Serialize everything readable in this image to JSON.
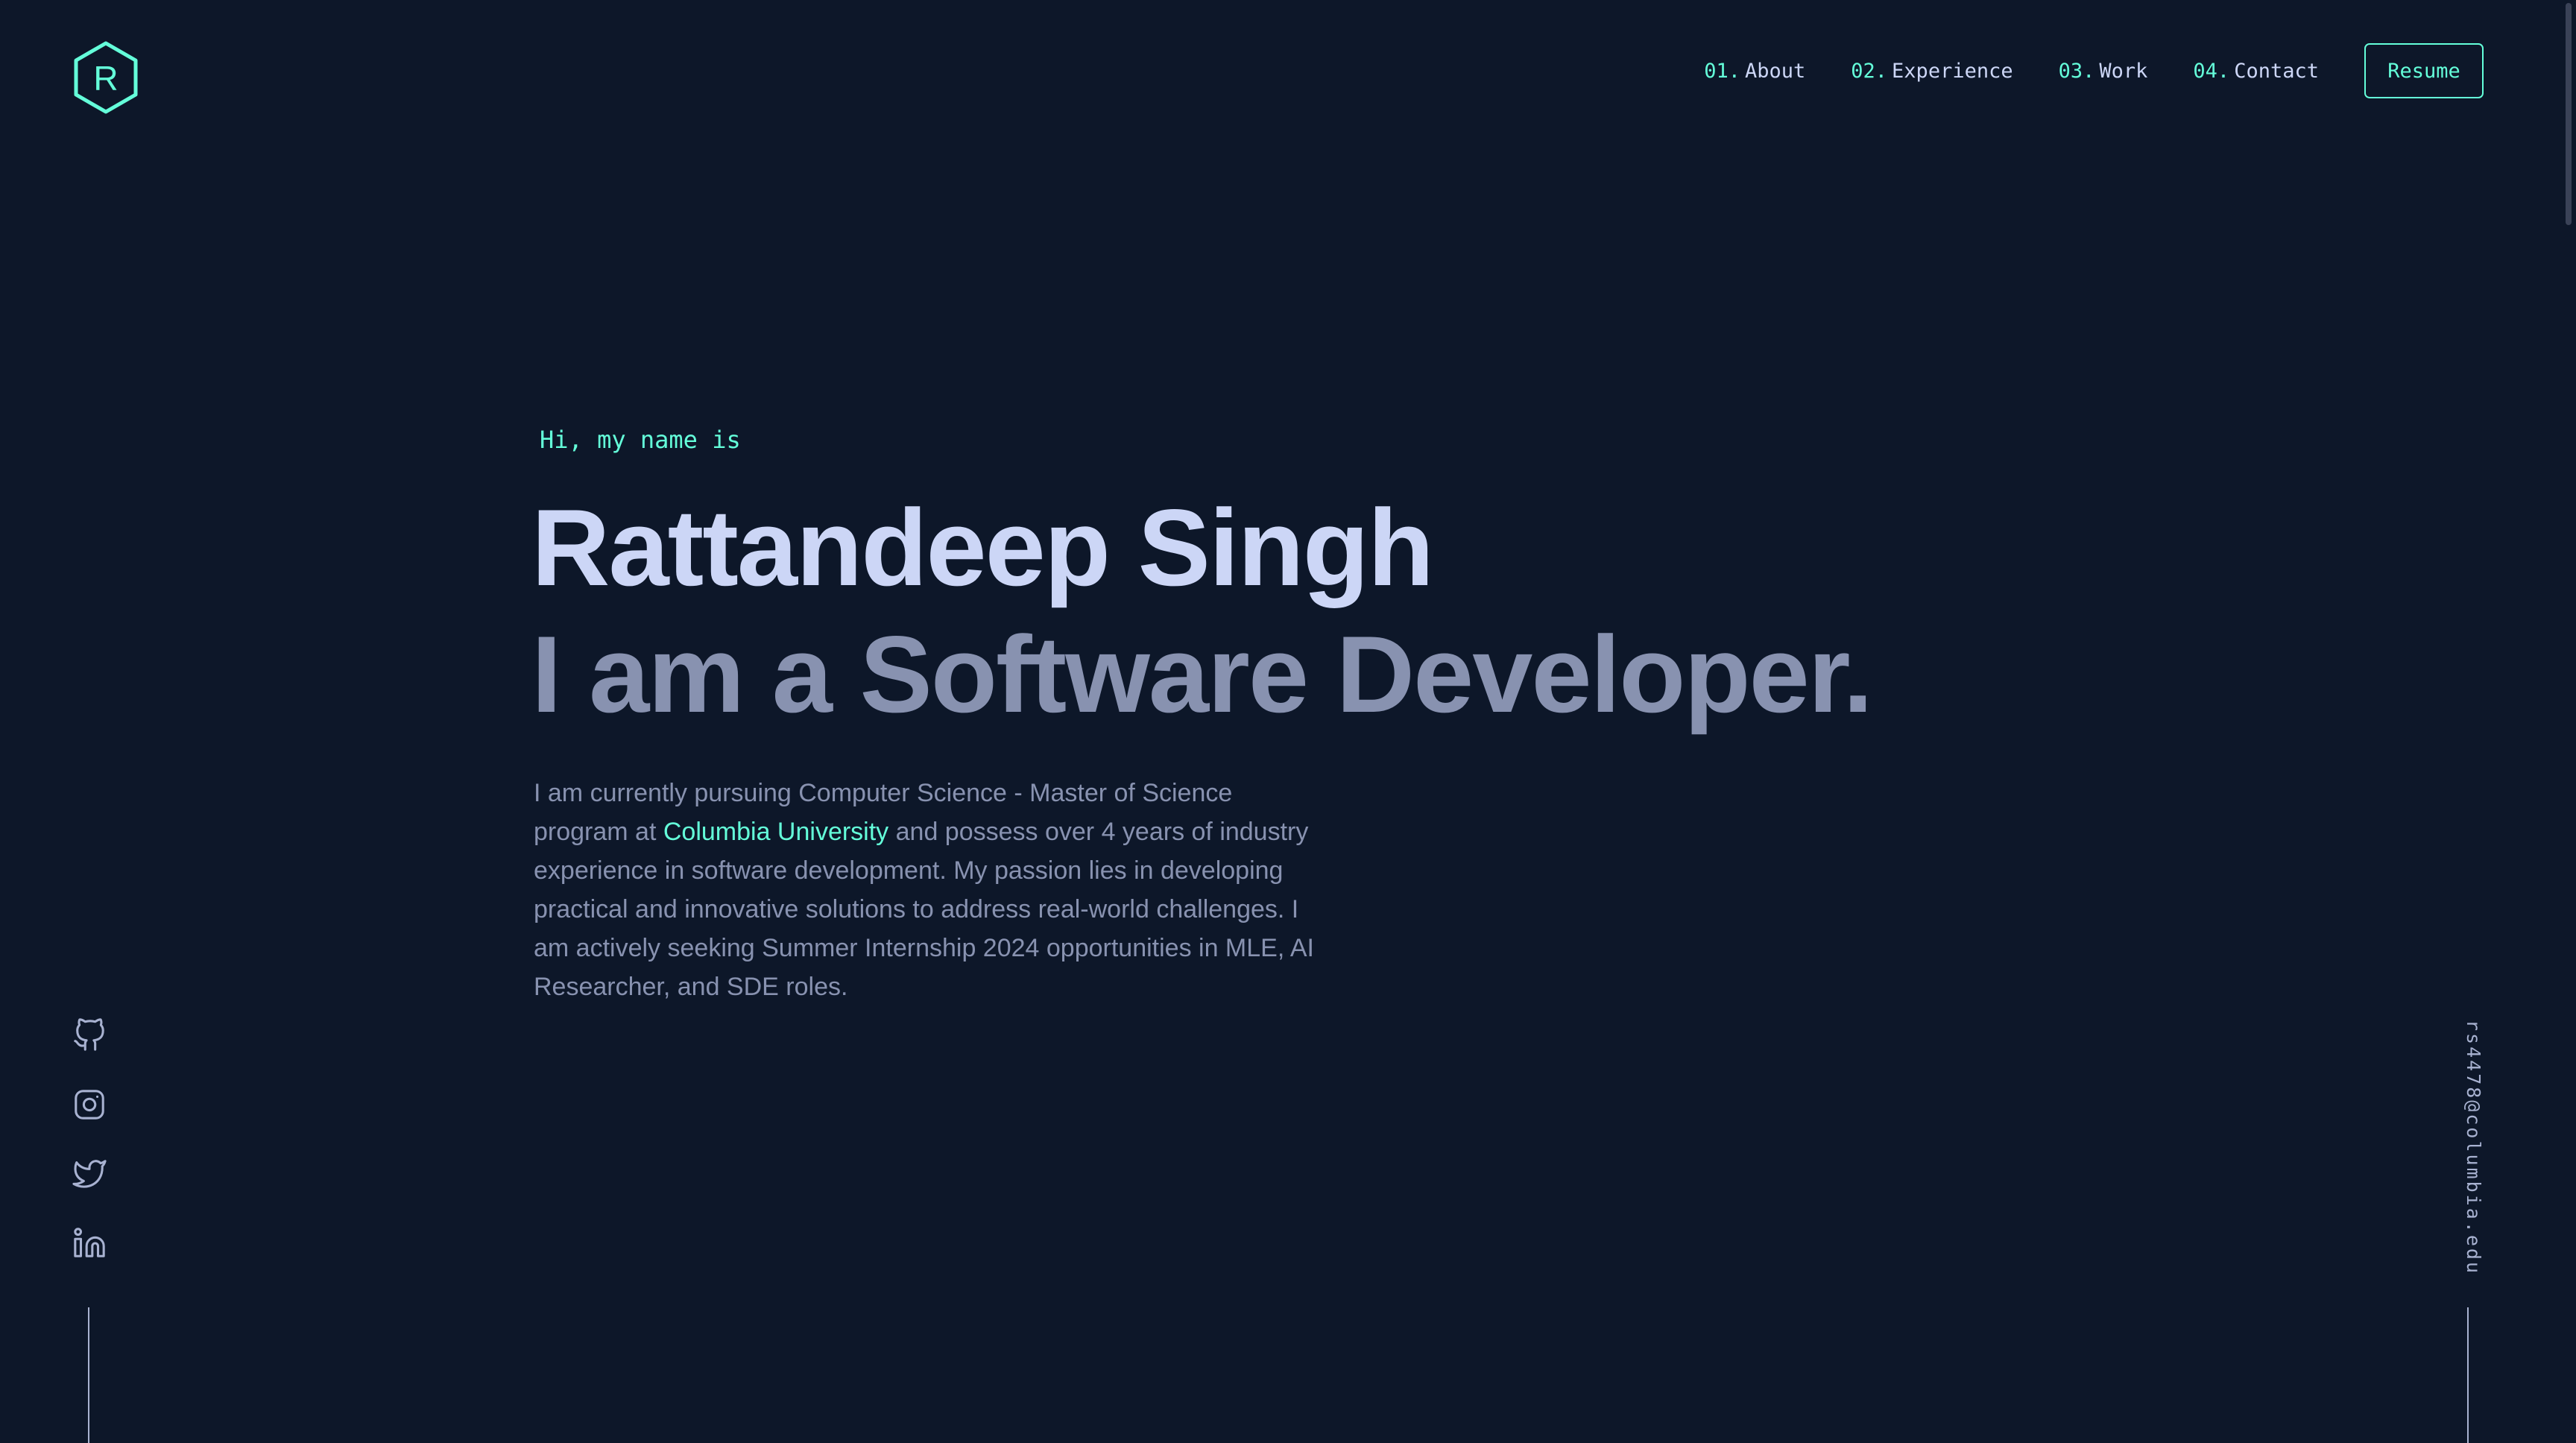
{
  "header": {
    "logo_letter": "R",
    "nav": [
      {
        "num": "01.",
        "label": "About"
      },
      {
        "num": "02.",
        "label": "Experience"
      },
      {
        "num": "03.",
        "label": "Work"
      },
      {
        "num": "04.",
        "label": "Contact"
      }
    ],
    "resume_label": "Resume"
  },
  "hero": {
    "greeting": "Hi, my name is",
    "name": "Rattandeep Singh",
    "tagline": "I am a Software Developer.",
    "bio": {
      "line1": "I am currently pursuing Computer Science - Master of Science",
      "line2_before": "program at ",
      "line2_link": "Columbia University",
      "line2_after": " and possess over 4 years of industry",
      "line3": "experience in software development. My passion lies in developing",
      "line4": "practical and innovative solutions to address real-world challenges. I",
      "line5": "am actively seeking Summer Internship 2024 opportunities in MLE, AI",
      "line6": "Researcher, and SDE roles."
    }
  },
  "socials": [
    {
      "icon": "github-icon"
    },
    {
      "icon": "instagram-icon"
    },
    {
      "icon": "twitter-icon"
    },
    {
      "icon": "linkedin-icon"
    }
  ],
  "email": "rs4478@columbia.edu",
  "colors": {
    "background": "#0d1729",
    "accent": "#64ffda",
    "heading": "#ccd6f6",
    "body_text": "#8892b0",
    "line": "#a8b2d1"
  }
}
